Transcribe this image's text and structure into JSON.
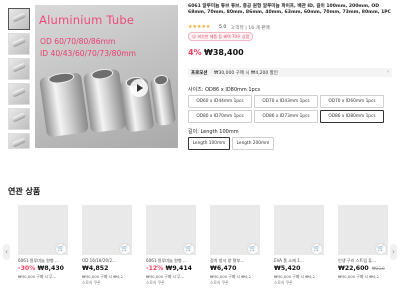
{
  "gallery": {
    "image_text_title": "Aluminium Tube",
    "image_text_od": "OD 60/70/80/86mm",
    "image_text_id": "ID 40/43/60/70/73/80mm"
  },
  "product": {
    "title": "6061 알루미늄 튜브 튜브, 중공 원형 알루미늄 파이프, 배관 ID, 길이 100mm, 200mm, OD 68mm, 70mm, 80mm, 86mm, 40mm, 63mm, 60mm, 70mm, 73mm, 80mm, 1PC",
    "stars": "★★★★★",
    "rating": "5.0",
    "reviews": "3 리뷰 | 16 개 판매",
    "tag": "☺ 비슷한 제품 등 혜택 70우 상품",
    "discount": "4%",
    "price": "₩38,400",
    "promo_label": "프로모션",
    "promo_text": "₩30,000 구매 시 ₩4,200 할인",
    "promo_chevron": "›"
  },
  "options": {
    "size_label": "사이즈: OD86 x ID80mm 1pcs",
    "sizes": [
      "OD60 x ID44mm 1pcs",
      "OD70 x ID43mm 1pcs",
      "OD70 x ID60mm 1pcs",
      "OD80 x ID70mm 1pcs",
      "OD86 x ID73mm 1pcs",
      "OD86 x ID80mm 1pcs"
    ],
    "length_label": "길이: Length 100mm",
    "lengths": [
      "Length 100mm",
      "Length 200mm"
    ]
  },
  "related": {
    "heading": "연관 상품",
    "prev_arrow": "‹",
    "next_arrow": "›",
    "items": [
      {
        "name": "6061 알루미늄 원형 ...",
        "discount": "-30%",
        "price": "₩8,430",
        "delivery": "₩30,000 구매 시 무...",
        "extra": "",
        "cart": "🛒"
      },
      {
        "name": "OD 16/18/20/2...",
        "discount": "",
        "price": "₩4,852",
        "delivery": "₩30,000 구매 시 ₩4,2",
        "extra": "스토어 쿠폰",
        "cart": "🛒"
      },
      {
        "name": "6061 알루미늄 원형 ...",
        "discount": "-12%",
        "price": "₩9,414",
        "delivery": "₩30,000 구매 시 무...",
        "extra": "스토어 쿠폰",
        "cart": "🛒"
      },
      {
        "name": "정치 방식 양 탈부...",
        "discount": "",
        "price": "₩6,470",
        "delivery": "₩30,000 구매 시 ₩4,2",
        "extra": "스토어 쿠폰",
        "cart": "🛒"
      },
      {
        "name": "EVA 폼 소재 1...",
        "discount": "",
        "price": "₩5,420",
        "delivery": "₩30,000 구매 시 ₩4,2",
        "extra": "스토어 쿠폰",
        "cart": "🛒"
      },
      {
        "name": "인생 구리 스트립 튜...",
        "discount": "",
        "price": "₩22,600",
        "old_price": "₩22,8",
        "delivery": "₩30,000 구매 시 ₩4,2",
        "extra": "",
        "cart": "🛒"
      }
    ]
  },
  "colors": {
    "accent": "#f23d5c",
    "star": "#f5a623",
    "image_text": "#f04a7a"
  }
}
